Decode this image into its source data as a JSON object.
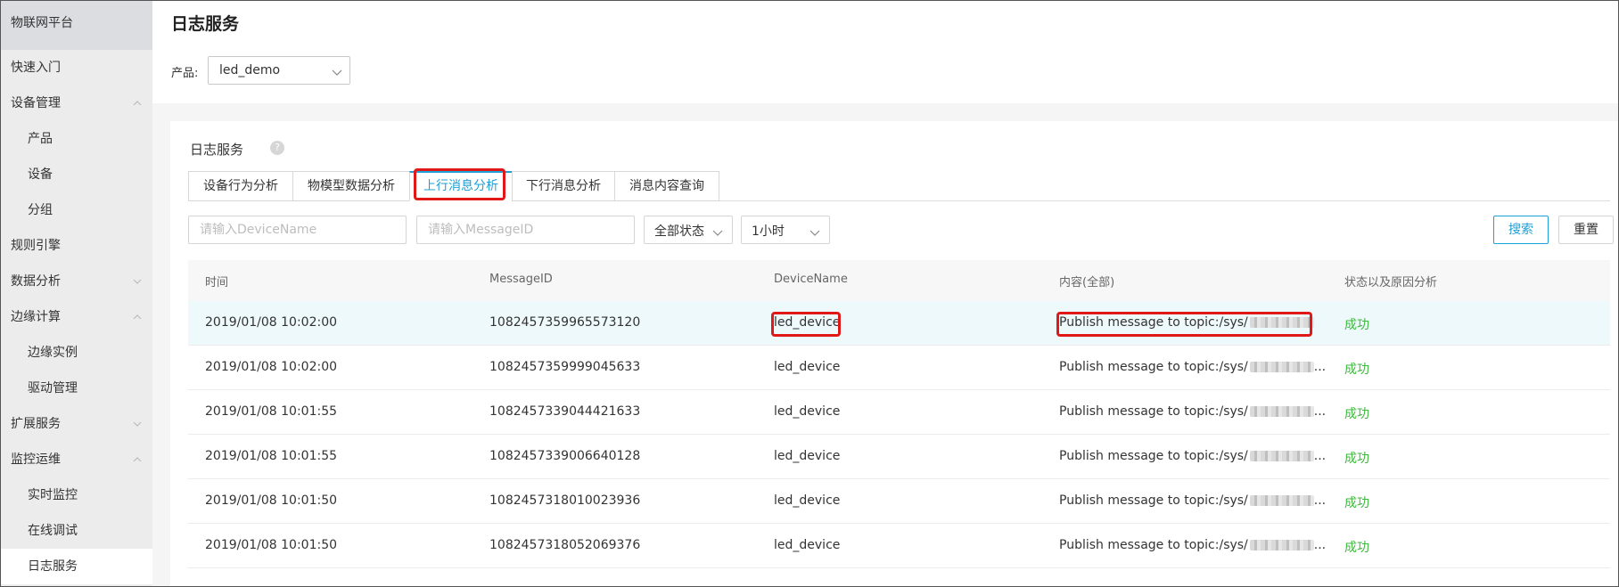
{
  "sidebar": {
    "brand": "物联网平台",
    "items": [
      {
        "label": "快速入门"
      },
      {
        "label": "设备管理"
      },
      {
        "label": "产品"
      },
      {
        "label": "设备"
      },
      {
        "label": "分组"
      },
      {
        "label": "规则引擎"
      },
      {
        "label": "数据分析"
      },
      {
        "label": "边缘计算"
      },
      {
        "label": "边缘实例"
      },
      {
        "label": "驱动管理"
      },
      {
        "label": "扩展服务"
      },
      {
        "label": "监控运维"
      },
      {
        "label": "实时监控"
      },
      {
        "label": "在线调试"
      },
      {
        "label": "日志服务"
      }
    ]
  },
  "header": {
    "title": "日志服务",
    "product_label": "产品:",
    "product_value": "led_demo"
  },
  "panel": {
    "title": "日志服务",
    "help_glyph": "?",
    "tabs": [
      {
        "label": "设备行为分析"
      },
      {
        "label": "物模型数据分析"
      },
      {
        "label": "上行消息分析"
      },
      {
        "label": "下行消息分析"
      },
      {
        "label": "消息内容查询"
      }
    ],
    "active_tab": "上行消息分析"
  },
  "filters": {
    "device_name_placeholder": "请输入DeviceName",
    "message_id_placeholder": "请输入MessageID",
    "status_value": "全部状态",
    "time_value": "1小时",
    "search_label": "搜索",
    "reset_label": "重置"
  },
  "table": {
    "columns": [
      "时间",
      "MessageID",
      "DeviceName",
      "内容(全部)",
      "状态以及原因分析"
    ],
    "rows": [
      {
        "time": "2019/01/08 10:02:00",
        "message_id": "1082457359965573120",
        "device": "led_device",
        "content": "Publish message to topic:/sys/",
        "status": "成功"
      },
      {
        "time": "2019/01/08 10:02:00",
        "message_id": "1082457359999045633",
        "device": "led_device",
        "content": "Publish message to topic:/sys/",
        "status": "成功"
      },
      {
        "time": "2019/01/08 10:01:55",
        "message_id": "1082457339044421633",
        "device": "led_device",
        "content": "Publish message to topic:/sys/",
        "status": "成功"
      },
      {
        "time": "2019/01/08 10:01:55",
        "message_id": "1082457339006640128",
        "device": "led_device",
        "content": "Publish message to topic:/sys/",
        "status": "成功"
      },
      {
        "time": "2019/01/08 10:01:50",
        "message_id": "1082457318010023936",
        "device": "led_device",
        "content": "Publish message to topic:/sys/",
        "status": "成功"
      },
      {
        "time": "2019/01/08 10:01:50",
        "message_id": "1082457318052069376",
        "device": "led_device",
        "content": "Publish message to topic:/sys/",
        "status": "成功"
      }
    ],
    "ellipsis": "..."
  },
  "colors": {
    "accent": "#1e9fd6",
    "success": "#3cb93c",
    "highlight": "#e01818"
  }
}
